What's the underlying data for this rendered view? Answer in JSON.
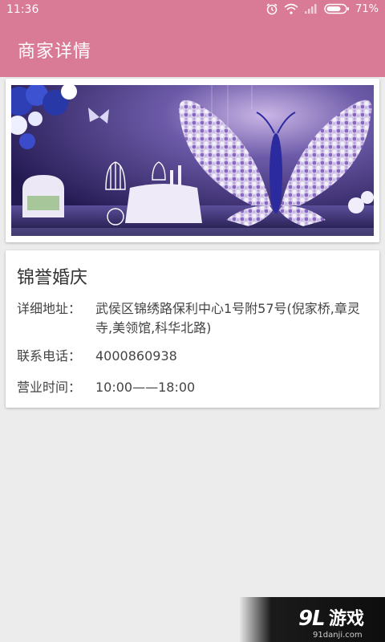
{
  "status_bar": {
    "time": "11:36",
    "battery": "71%",
    "icons": [
      "alarm-icon",
      "wifi-icon",
      "signal-icon",
      "battery-icon"
    ]
  },
  "header": {
    "title": "商家详情",
    "background_color": "#d97a96"
  },
  "banner": {
    "image": "wedding-stage-butterfly-photo"
  },
  "merchant": {
    "name": "锦誉婚庆",
    "address_label": "详细地址：",
    "address_value": "武侯区锦绣路保利中心1号附57号(倪家桥,章灵寺,美领馆,科华北路)",
    "phone_label": "联系电话：",
    "phone_value": "4000860938",
    "hours_label": "营业时间：",
    "hours_value": "10:00——18:00"
  },
  "watermark": {
    "logo": "91-logo",
    "brand_text": "游戏",
    "site": "91danji.com"
  }
}
